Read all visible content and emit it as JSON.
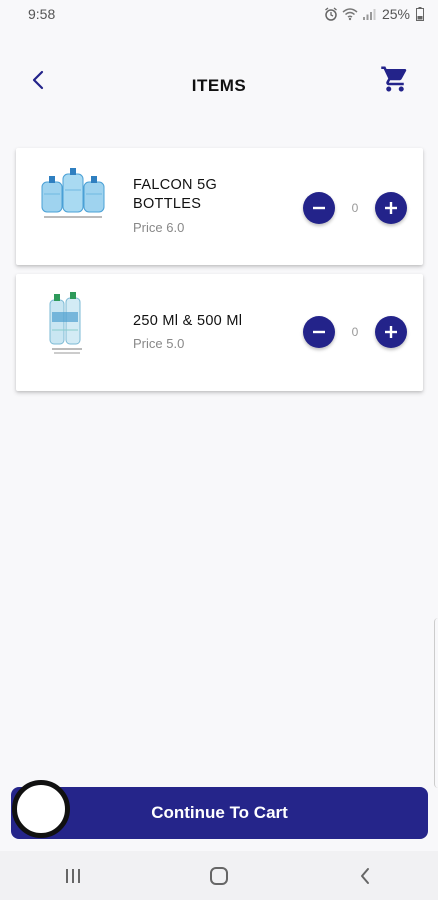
{
  "status_bar": {
    "time": "9:58",
    "battery": "25%",
    "icons": [
      "alarm-icon",
      "wifi-icon",
      "signal-icon",
      "battery-icon"
    ]
  },
  "header": {
    "title": "ITEMS",
    "back_icon": "back-arrow-icon",
    "cart_icon": "cart-icon"
  },
  "items": [
    {
      "name": "FALCON 5G BOTTLES",
      "price": "Price 6.0",
      "quantity": "0",
      "image": "water-jugs-image"
    },
    {
      "name": "250 Ml & 500 Ml",
      "price": "Price 5.0",
      "quantity": "0",
      "image": "water-bottles-pack-image"
    }
  ],
  "footer": {
    "continue_label": "Continue To Cart"
  },
  "nav_bar": {
    "icons": [
      "recents-icon",
      "home-icon",
      "back-icon"
    ]
  },
  "colors": {
    "accent": "#23238a",
    "background": "#f8f8fa",
    "card": "#ffffff"
  }
}
